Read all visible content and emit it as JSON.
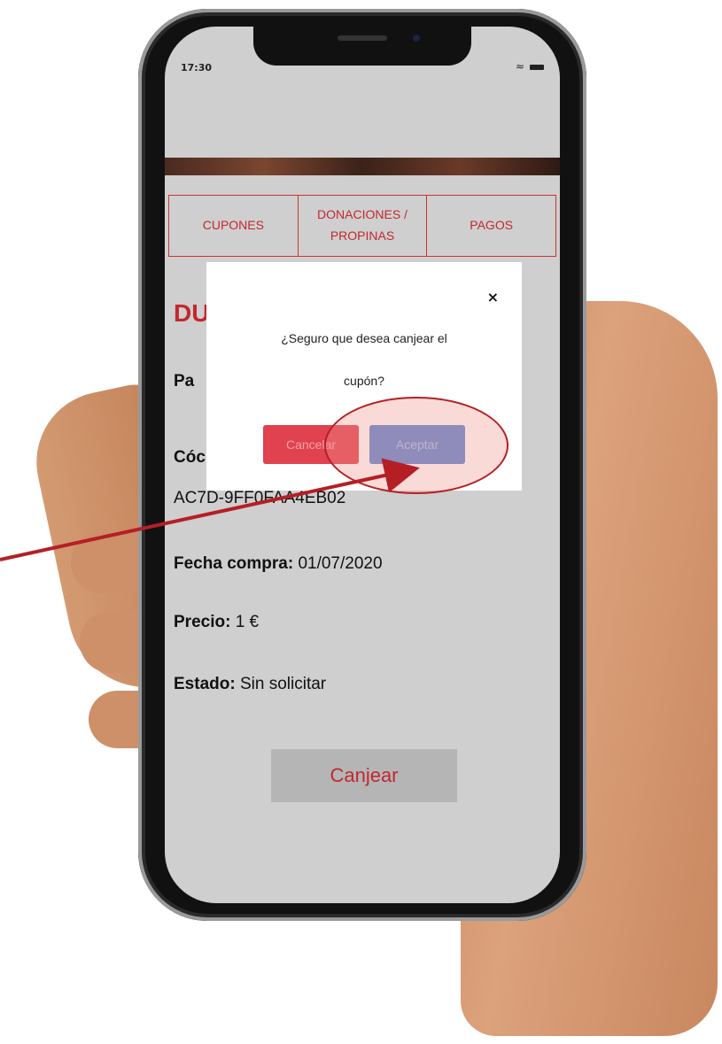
{
  "status_bar": {
    "time": "17:30"
  },
  "tabs": [
    {
      "label": "CUPONES"
    },
    {
      "label": "DONACIONES / PROPINAS"
    },
    {
      "label": "PAGOS"
    }
  ],
  "coupon": {
    "title_partial": "DU",
    "line1_partial": "Pa",
    "codigo_label_partial": "Cóc",
    "codigo_value": "AC7D-9FF0FAA4EB02",
    "fecha_label": "Fecha compra:",
    "fecha_value": "01/07/2020",
    "precio_label": "Precio:",
    "precio_value": "1 €",
    "estado_label": "Estado:",
    "estado_value": "Sin solicitar",
    "canjear_label": "Canjear"
  },
  "modal": {
    "close": "×",
    "message_line1": "¿Seguro que desea canjear el",
    "message_line2": "cupón?",
    "cancel_label": "Cancelar",
    "accept_label": "Aceptar"
  },
  "colors": {
    "accent_red": "#c2282f",
    "cancel_red": "#e0424f",
    "accept_blue": "#5b88d6",
    "annotation_red": "#b41f25"
  }
}
